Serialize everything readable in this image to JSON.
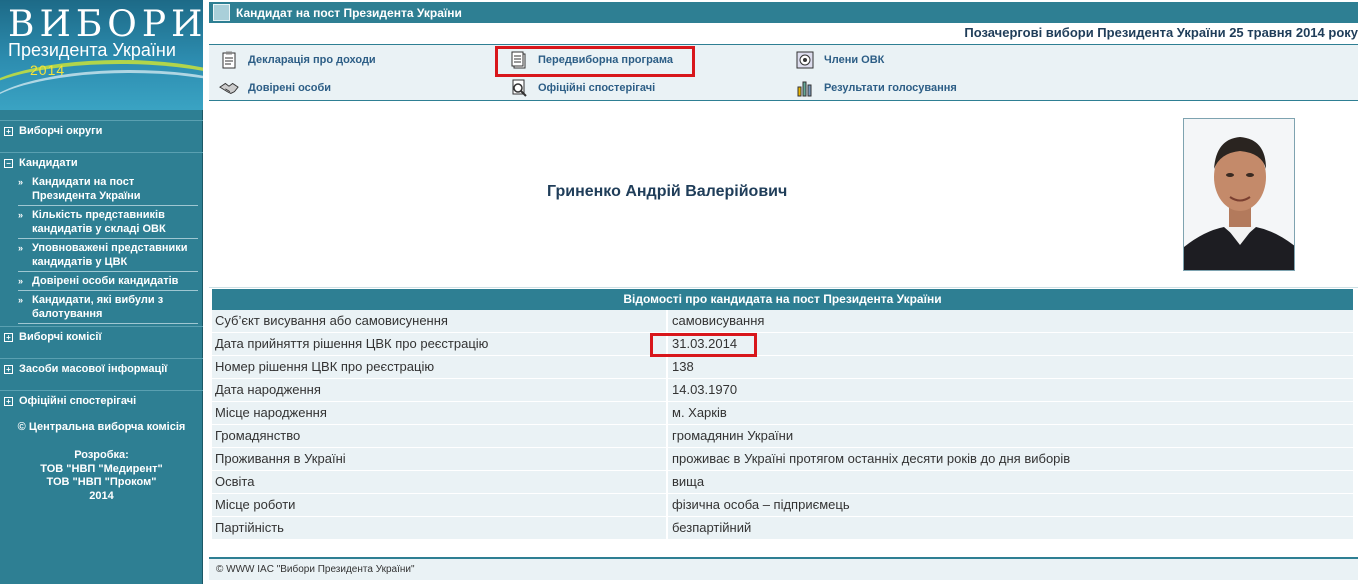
{
  "logo": {
    "word": "ВИБОРИ",
    "subtitle": "Президента України",
    "year": "2014"
  },
  "sidebar": {
    "sections": [
      {
        "label": "Виборчі округи"
      },
      {
        "label": "Кандидати"
      },
      {
        "label": "Виборчі комісії"
      },
      {
        "label": "Засоби масової інформації"
      },
      {
        "label": "Офіційні спостерігачі"
      }
    ],
    "candidate_items": [
      {
        "label": "Кандидати на пост Президента України"
      },
      {
        "label": "Кількість представників кандидатів у складі ОВК"
      },
      {
        "label": "Уповноважені представники кандидатів у ЦВК"
      },
      {
        "label": "Довірені особи кандидатів"
      },
      {
        "label": "Кандидати, які вибули з балотування"
      }
    ],
    "copyright": "© Центральна виборча комісія",
    "dev_title": "Розробка:",
    "dev_line1": "ТОВ \"НВП \"Медирент\"",
    "dev_line2": "ТОВ \"НВП \"Проком\"",
    "dev_year": "2014"
  },
  "header": {
    "title": "Кандидат на пост Президента України",
    "election": "Позачергові вибори Президента України 25 травня 2014 року"
  },
  "links": {
    "declaration": "Декларація про доходи",
    "program": "Передвиборна програма",
    "ovk_members": "Члени ОВК",
    "trusted": "Довірені особи",
    "observers": "Офіційні спостерігачі",
    "results": "Результати голосування"
  },
  "candidate": {
    "name": "Гриненко Андрій Валерійович"
  },
  "info": {
    "title": "Відомості про кандидата на пост Президента України",
    "rows": [
      {
        "key": "Суб’єкт висування або самовисунення",
        "value": "самовисування"
      },
      {
        "key": "Дата прийняття рішення ЦВК про реєстрацію",
        "value": "31.03.2014"
      },
      {
        "key": "Номер рішення ЦВК про реєстрацію",
        "value": "138"
      },
      {
        "key": "Дата народження",
        "value": "14.03.1970"
      },
      {
        "key": "Місце народження",
        "value": "м. Харків"
      },
      {
        "key": "Громадянство",
        "value": "громадянин України"
      },
      {
        "key": "Проживання в Україні",
        "value": "проживає в Україні протягом останніх десяти років до дня виборів"
      },
      {
        "key": "Освіта",
        "value": "вища"
      },
      {
        "key": "Місце роботи",
        "value": "фізична особа – підприємець"
      },
      {
        "key": "Партійність",
        "value": "безпартійний"
      }
    ]
  },
  "footer": {
    "text": "© WWW IAC \"Вибори Президента України\""
  },
  "colors": {
    "accent": "#2e7f93",
    "panel": "#eaf2f5",
    "highlight": "#d8161b"
  }
}
